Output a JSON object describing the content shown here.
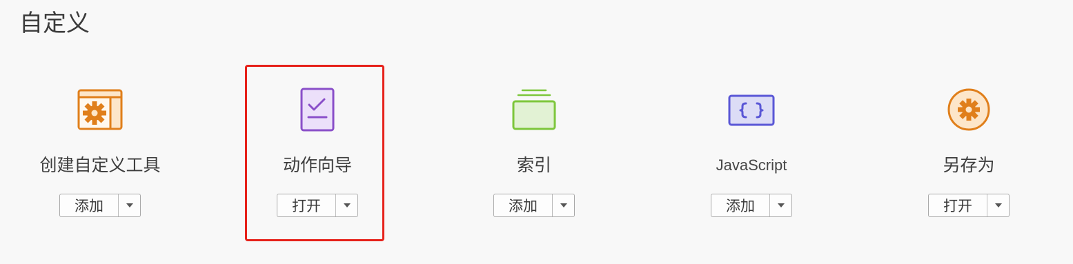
{
  "section": {
    "title": "自定义"
  },
  "tools": [
    {
      "label": "创建自定义工具",
      "button": "添加",
      "icon": "custom-tool-gear-icon"
    },
    {
      "label": "动作向导",
      "button": "打开",
      "icon": "action-wizard-checklist-icon"
    },
    {
      "label": "索引",
      "button": "添加",
      "icon": "index-stack-icon"
    },
    {
      "label": "JavaScript",
      "button": "添加",
      "icon": "javascript-braces-icon"
    },
    {
      "label": "另存为",
      "button": "打开",
      "icon": "save-as-gear-icon"
    }
  ],
  "colors": {
    "custom_tool": "#e07f1b",
    "action_wizard": "#8a4fc9",
    "index": "#7dc63b",
    "javascript": "#5a57d6",
    "save_as": "#e07f1b",
    "highlight": "#e6211a"
  }
}
